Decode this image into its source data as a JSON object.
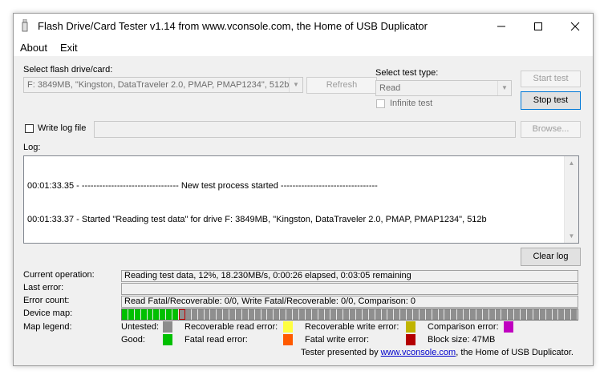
{
  "window": {
    "title": "Flash Drive/Card Tester v1.14 from www.vconsole.com, the Home of USB Duplicator"
  },
  "menu": {
    "about": "About",
    "exit": "Exit"
  },
  "drive": {
    "label": "Select flash drive/card:",
    "value": "F: 3849MB, \"Kingston, DataTraveler 2.0, PMAP, PMAP1234\", 512b",
    "refresh": "Refresh"
  },
  "test_type": {
    "label": "Select test type:",
    "value": "Read",
    "infinite_test": "Infinite test"
  },
  "buttons": {
    "start_test": "Start test",
    "stop_test": "Stop test",
    "browse": "Browse...",
    "clear_log": "Clear log"
  },
  "write_log": {
    "label": "Write log file",
    "path": ""
  },
  "log": {
    "label": "Log:",
    "lines": [
      "00:01:33.35 - --------------------------------- New test process started ---------------------------------",
      "00:01:33.37 - Started \"Reading test data\" for drive F: 3849MB, \"Kingston, DataTraveler 2.0, PMAP, PMAP1234\", 512b"
    ]
  },
  "status": {
    "current_operation_label": "Current operation:",
    "current_operation": "Reading test data, 12%, 18.230MB/s, 0:00:26 elapsed, 0:03:05 remaining",
    "last_error_label": "Last error:",
    "last_error": "",
    "error_count_label": "Error count:",
    "error_count": "Read Fatal/Recoverable: 0/0, Write Fatal/Recoverable: 0/0, Comparison: 0",
    "device_map_label": "Device map:",
    "map_legend_label": "Map legend:"
  },
  "device_map": {
    "total_cells": 72,
    "good_cells": 9,
    "current_cell": 9,
    "good_color": "#00c000",
    "current_color": "#c00000",
    "untested_color": "#8f8f8f"
  },
  "legend": {
    "untested": {
      "label": "Untested:",
      "color": "#8c8c8c"
    },
    "good": {
      "label": "Good:",
      "color": "#00c000"
    },
    "recoverable_read": {
      "label": "Recoverable read error:",
      "color": "#ffff40"
    },
    "fatal_read": {
      "label": "Fatal read error:",
      "color": "#ff5a00"
    },
    "recoverable_write": {
      "label": "Recoverable write error:",
      "color": "#c0b400"
    },
    "fatal_write": {
      "label": "Fatal write error:",
      "color": "#b40000"
    },
    "comparison": {
      "label": "Comparison error:",
      "color": "#c000c0"
    },
    "block_size": {
      "label": "Block size: 47MB"
    }
  },
  "footer": {
    "prefix": "Tester presented by ",
    "link": "www.vconsole.com",
    "suffix": ", the Home of USB Duplicator."
  },
  "icons": {
    "app": "usb-drive-icon",
    "minimize": "minimize-icon",
    "maximize": "maximize-icon",
    "close": "close-icon"
  }
}
